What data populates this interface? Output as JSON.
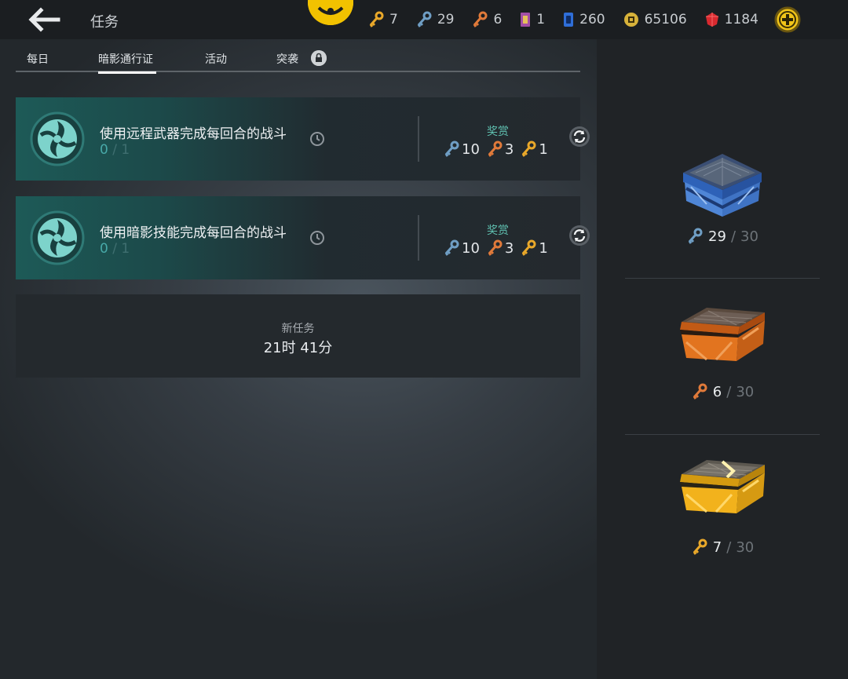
{
  "header": {
    "title": "任务",
    "currencies": [
      {
        "icon": "gold-key-icon",
        "value": "7",
        "color": "#e9a82a"
      },
      {
        "icon": "blue-key-icon",
        "value": "29",
        "color": "#6f9ec4"
      },
      {
        "icon": "orange-key-icon",
        "value": "6",
        "color": "#e07a3a"
      },
      {
        "icon": "pass-ticket-icon",
        "value": "1",
        "color": "#a34fa6"
      },
      {
        "icon": "blue-card-icon",
        "value": "260",
        "color": "#2f6ed8"
      },
      {
        "icon": "coin-icon",
        "value": "65106",
        "color": "#d7b23a"
      },
      {
        "icon": "red-gem-icon",
        "value": "1184",
        "color": "#d9292f"
      }
    ]
  },
  "tabs": [
    {
      "label": "每日"
    },
    {
      "label": "暗影通行证",
      "active": true
    },
    {
      "label": "活动"
    },
    {
      "label": "突袭",
      "locked": true
    }
  ],
  "tasks": [
    {
      "name": "使用远程武器完成每回合的战斗",
      "progress_current": "0",
      "progress_total": "1",
      "reward_label": "奖赏",
      "rewards": [
        {
          "icon": "blue-key-icon",
          "value": "10"
        },
        {
          "icon": "orange-key-icon",
          "value": "3"
        },
        {
          "icon": "gold-key-icon",
          "value": "1"
        }
      ]
    },
    {
      "name": "使用暗影技能完成每回合的战斗",
      "progress_current": "0",
      "progress_total": "1",
      "reward_label": "奖赏",
      "rewards": [
        {
          "icon": "blue-key-icon",
          "value": "10"
        },
        {
          "icon": "orange-key-icon",
          "value": "3"
        },
        {
          "icon": "gold-key-icon",
          "value": "1"
        }
      ]
    }
  ],
  "new_task": {
    "label": "新任务",
    "time": "21时 41分"
  },
  "chests": [
    {
      "name": "blue-chest",
      "key_icon": "blue-key-icon",
      "count": "29",
      "max": "30"
    },
    {
      "name": "orange-chest",
      "key_icon": "orange-key-icon",
      "count": "6",
      "max": "30"
    },
    {
      "name": "gold-chest",
      "key_icon": "gold-key-icon",
      "count": "7",
      "max": "30"
    }
  ],
  "colors": {
    "accent_teal": "#47a9a8",
    "reward_teal": "#5fc0b0",
    "blue_key": "#6f9ec4",
    "orange_key": "#e07a3a",
    "gold_key": "#e9a82a",
    "emblem_yellow": "#f2c200"
  }
}
